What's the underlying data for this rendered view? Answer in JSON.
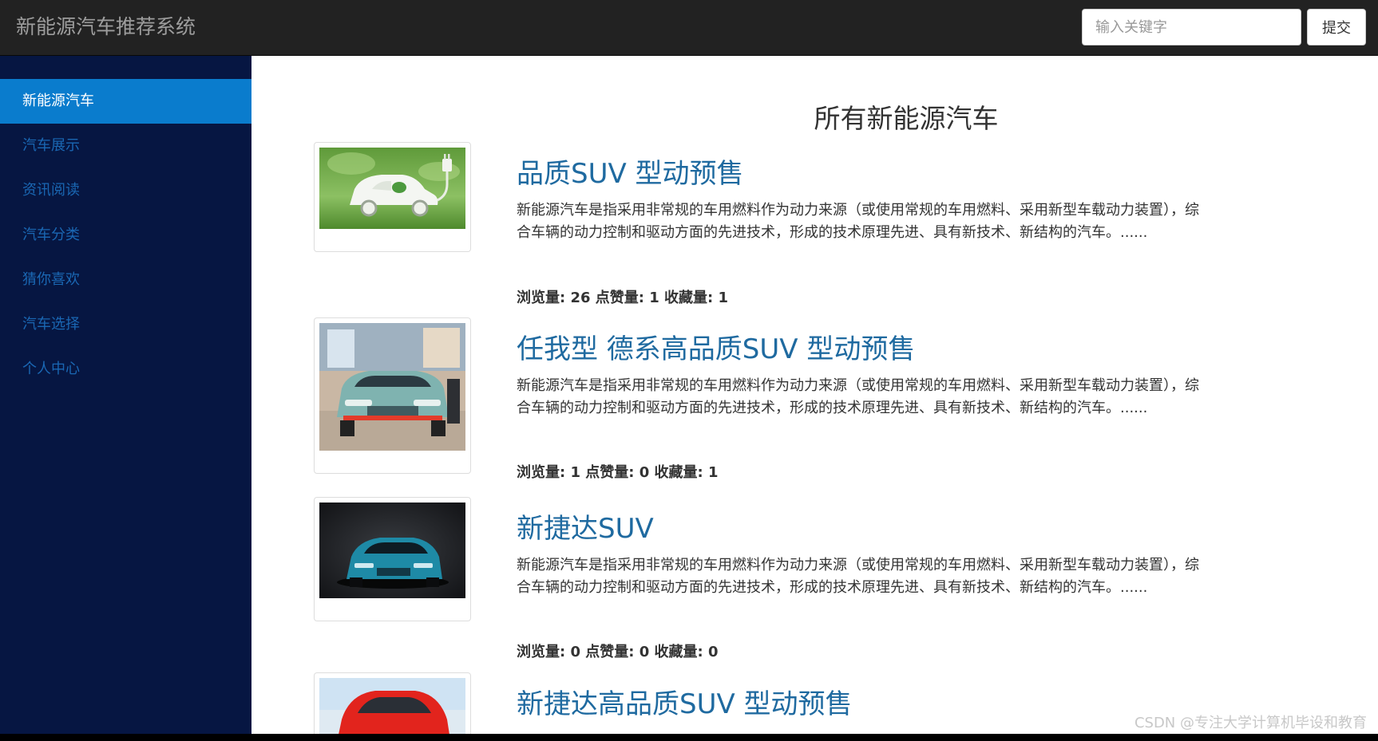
{
  "app": {
    "title": "新能源汽车推荐系统"
  },
  "search": {
    "placeholder": "输入关键字",
    "submit_label": "提交"
  },
  "sidebar": {
    "items": [
      {
        "label": "新能源汽车"
      },
      {
        "label": "汽车展示"
      },
      {
        "label": "资讯阅读"
      },
      {
        "label": "汽车分类"
      },
      {
        "label": "猜你喜欢"
      },
      {
        "label": "汽车选择"
      },
      {
        "label": "个人中心"
      }
    ]
  },
  "main": {
    "title": "所有新能源汽车",
    "cars": [
      {
        "name": "品质SUV 型动预售",
        "description": "新能源汽车是指采用非常规的车用燃料作为动力来源（或使用常规的车用燃料、采用新型车载动力装置），综合车辆的动力控制和驱动方面的先进技术，形成的技术原理先进、具有新技术、新结构的汽车。......",
        "stats": "浏览量: 26 点赞量: 1 收藏量: 1"
      },
      {
        "name": "任我型 德系高品质SUV 型动预售",
        "description": "新能源汽车是指采用非常规的车用燃料作为动力来源（或使用常规的车用燃料、采用新型车载动力装置），综合车辆的动力控制和驱动方面的先进技术，形成的技术原理先进、具有新技术、新结构的汽车。......",
        "stats": "浏览量: 1 点赞量: 0 收藏量: 1"
      },
      {
        "name": "新捷达SUV",
        "description": "新能源汽车是指采用非常规的车用燃料作为动力来源（或使用常规的车用燃料、采用新型车载动力装置），综合车辆的动力控制和驱动方面的先进技术，形成的技术原理先进、具有新技术、新结构的汽车。......",
        "stats": "浏览量: 0 点赞量: 0 收藏量: 0"
      },
      {
        "name": "新捷达高品质SUV 型动预售"
      }
    ]
  },
  "watermark": "CSDN @专注大学计算机毕设和教育",
  "colors": {
    "navbar": "#222222",
    "sidebar": "#061642",
    "sidebar_active": "#0a7ccd",
    "sidebar_link": "#1a67b3",
    "title_link": "#1f6aa0"
  }
}
